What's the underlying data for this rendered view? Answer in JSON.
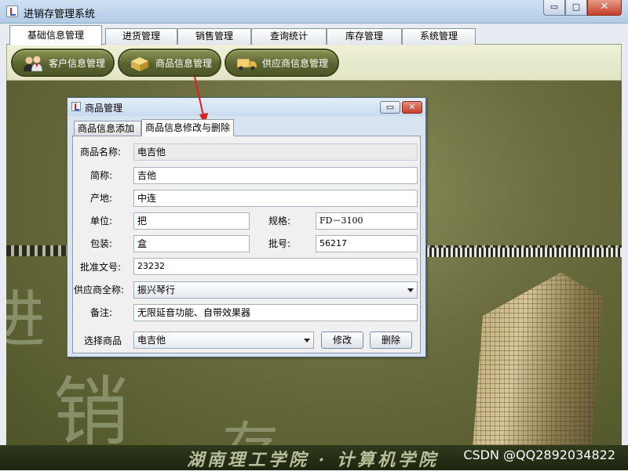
{
  "window": {
    "title": "进销存管理系统",
    "min_glyph": "▭",
    "max_glyph": "□",
    "close_glyph": "✕"
  },
  "menu_tabs": [
    {
      "label": "基础信息管理",
      "active": true
    },
    {
      "label": "进货管理",
      "active": false
    },
    {
      "label": "销售管理",
      "active": false
    },
    {
      "label": "查询统计",
      "active": false
    },
    {
      "label": "库存管理",
      "active": false
    },
    {
      "label": "系统管理",
      "active": false
    }
  ],
  "toolbar": {
    "buttons": [
      {
        "label": "客户信息管理",
        "icon": "customers-icon"
      },
      {
        "label": "商品信息管理",
        "icon": "goods-box-icon"
      },
      {
        "label": "供应商信息管理",
        "icon": "delivery-truck-icon"
      }
    ]
  },
  "background": {
    "chars": [
      "进",
      "销",
      "存"
    ],
    "school": "湖南理工学院 · 计算机学院",
    "watermark": "CSDN @QQ2892034822"
  },
  "colors": {
    "accent_red": "#e02020",
    "toolbar_green": "#5a6430"
  },
  "dialog": {
    "title": "商品管理",
    "tabs": [
      {
        "label": "商品信息添加",
        "active": false
      },
      {
        "label": "商品信息修改与删除",
        "active": true
      }
    ],
    "form": {
      "name_label": "商品名称:",
      "name_value": "电吉他",
      "short_label": "简称:",
      "short_value": "吉他",
      "origin_label": "产地:",
      "origin_value": "中连",
      "unit_label": "单位:",
      "unit_value": "把",
      "spec_label": "规格:",
      "spec_value": "FD－3100",
      "package_label": "包装:",
      "package_value": "盒",
      "batch_label": "批号:",
      "batch_value": "56217",
      "approval_label": "批准文号:",
      "approval_value": "23232",
      "supplier_label": "供应商全称:",
      "supplier_value": "振兴琴行",
      "remark_label": "备注:",
      "remark_value": "无限延音功能、自带效果器",
      "select_label": "选择商品",
      "select_value": "电吉他",
      "modify_button": "修改",
      "delete_button": "删除"
    }
  }
}
